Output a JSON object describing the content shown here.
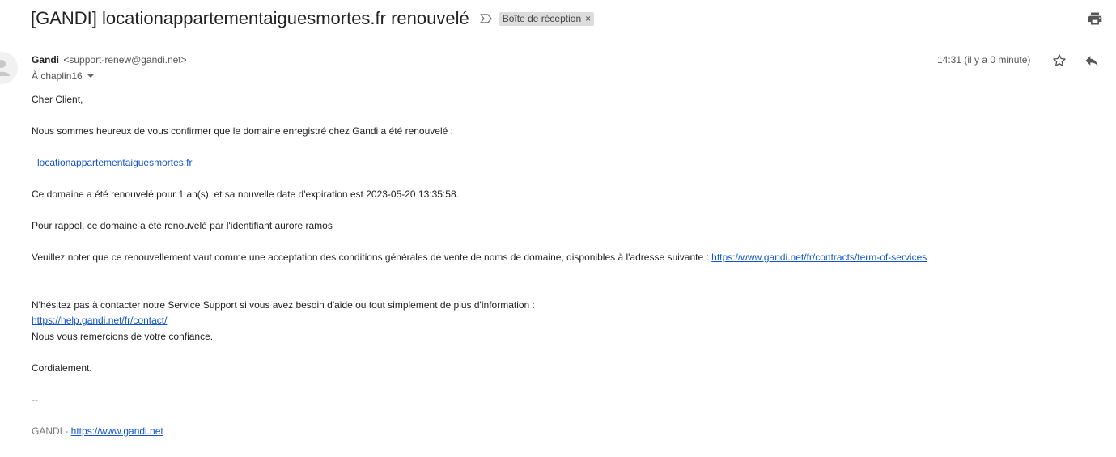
{
  "subject": {
    "title": "[GANDI] locationappartementaiguesmortes.fr renouvelé",
    "label": "Boîte de réception",
    "label_close": "×"
  },
  "message": {
    "sender_name": "Gandi",
    "sender_email": "<support-renew@gandi.net>",
    "recipient": "À chaplin16",
    "timestamp": "14:31 (il y a 0 minute)"
  },
  "body": {
    "greeting": "Cher Client,",
    "confirm": "Nous sommes heureux de vous confirmer que le domaine enregistré chez Gandi a été renouvelé :",
    "domain_link": "locationappartementaiguesmortes.fr",
    "renewal_info": "Ce domaine a été renouvelé pour 1 an(s), et sa nouvelle date d'expiration est 2023-05-20 13:35:58.",
    "reminder": "Pour rappel, ce domaine a été renouvelé par l'identifiant  aurore ramos",
    "terms_text": "Veuillez noter que ce renouvellement vaut comme une acceptation des conditions générales de vente de noms de domaine, disponibles à l'adresse suivante : ",
    "terms_link": "https://www.gandi.net/fr/contracts/term-of-services",
    "contact_text": "N'hésitez pas à contacter notre Service Support si vous avez besoin d'aide ou tout simplement de plus d'information :",
    "contact_link": "https://help.gandi.net/fr/contact/",
    "thanks": "Nous vous remercions de votre confiance.",
    "closing": "Cordialement.",
    "separator": "--",
    "signature_text": "GANDI - ",
    "signature_link": "https://www.gandi.net"
  },
  "icons": {
    "important": "important-marker-icon",
    "print": "print-icon",
    "star": "star-icon",
    "reply": "reply-icon",
    "avatar": "person-icon"
  },
  "colors": {
    "link": "#1155cc",
    "chip_bg": "#dddddd",
    "text": "#222222",
    "muted": "#777777"
  }
}
